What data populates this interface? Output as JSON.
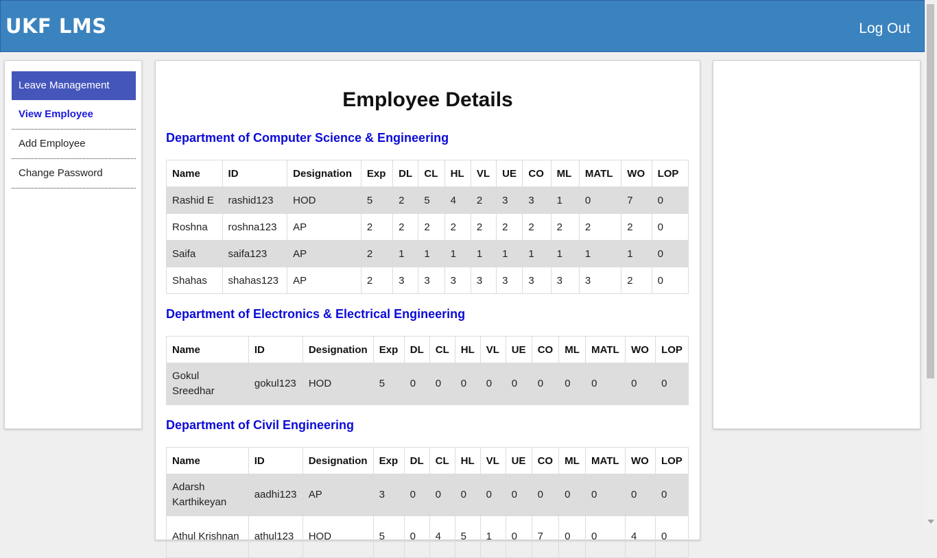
{
  "header": {
    "brand": "UKF LMS",
    "logout_label": "Log Out"
  },
  "sidebar": {
    "items": [
      {
        "label": "Leave Management"
      },
      {
        "label": "View Employee"
      },
      {
        "label": "Add Employee"
      },
      {
        "label": "Change Password"
      }
    ]
  },
  "main": {
    "title": "Employee Details",
    "columns": [
      "Name",
      "ID",
      "Designation",
      "Exp",
      "DL",
      "CL",
      "HL",
      "VL",
      "UE",
      "CO",
      "ML",
      "MATL",
      "WO",
      "LOP"
    ],
    "departments": [
      {
        "name": "Department of Computer Science & Engineering",
        "rows": [
          [
            "Rashid E",
            "rashid123",
            "HOD",
            "5",
            "2",
            "5",
            "4",
            "2",
            "3",
            "3",
            "1",
            "0",
            "7",
            "0"
          ],
          [
            "Roshna",
            "roshna123",
            "AP",
            "2",
            "2",
            "2",
            "2",
            "2",
            "2",
            "2",
            "2",
            "2",
            "2",
            "0"
          ],
          [
            "Saifa",
            "saifa123",
            "AP",
            "2",
            "1",
            "1",
            "1",
            "1",
            "1",
            "1",
            "1",
            "1",
            "1",
            "0"
          ],
          [
            "Shahas",
            "shahas123",
            "AP",
            "2",
            "3",
            "3",
            "3",
            "3",
            "3",
            "3",
            "3",
            "3",
            "2",
            "0"
          ]
        ]
      },
      {
        "name": "Department of Electronics & Electrical Engineering",
        "rows": [
          [
            "Gokul Sreedhar",
            "gokul123",
            "HOD",
            "5",
            "0",
            "0",
            "0",
            "0",
            "0",
            "0",
            "0",
            "0",
            "0",
            "0"
          ]
        ]
      },
      {
        "name": "Department of Civil Engineering",
        "rows": [
          [
            "Adarsh Karthikeyan",
            "aadhi123",
            "AP",
            "3",
            "0",
            "0",
            "0",
            "0",
            "0",
            "0",
            "0",
            "0",
            "0",
            "0"
          ],
          [
            "Athul Krishnan",
            "athul123",
            "HOD",
            "5",
            "0",
            "4",
            "5",
            "1",
            "0",
            "7",
            "0",
            "0",
            "4",
            "0"
          ]
        ]
      }
    ]
  }
}
